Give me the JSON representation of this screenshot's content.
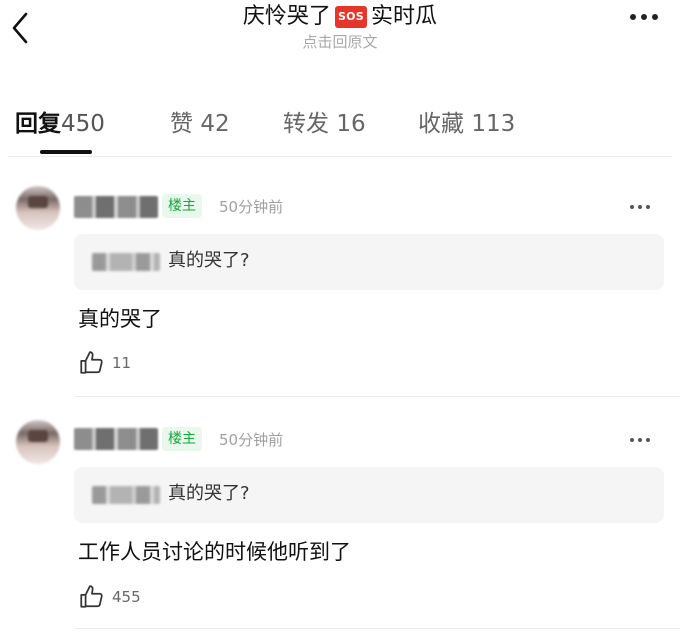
{
  "header": {
    "title_before": "庆怜哭了",
    "title_emoji": "SOS",
    "title_after": "实时瓜",
    "subtitle": "点击回原文",
    "back_icon": "chevron-left-icon",
    "more_icon": "more-horizontal-icon"
  },
  "tabs": [
    {
      "label": "回复",
      "count": "450",
      "active": true
    },
    {
      "label": "赞",
      "count": "42",
      "active": false
    },
    {
      "label": "转发",
      "count": "16",
      "active": false
    },
    {
      "label": "收藏",
      "count": "113",
      "active": false
    }
  ],
  "comments": [
    {
      "author_badge": "楼主",
      "time": "50分钟前",
      "quote_text": "真的哭了?",
      "text": "真的哭了",
      "likes": "11"
    },
    {
      "author_badge": "楼主",
      "time": "50分钟前",
      "quote_text": "真的哭了?",
      "text": "工作人员讨论的时候他听到了",
      "likes": "455"
    }
  ],
  "colors": {
    "badge_green": "#19a53b",
    "badge_bg": "#e9f8ec",
    "sos_red": "#e8352a"
  }
}
